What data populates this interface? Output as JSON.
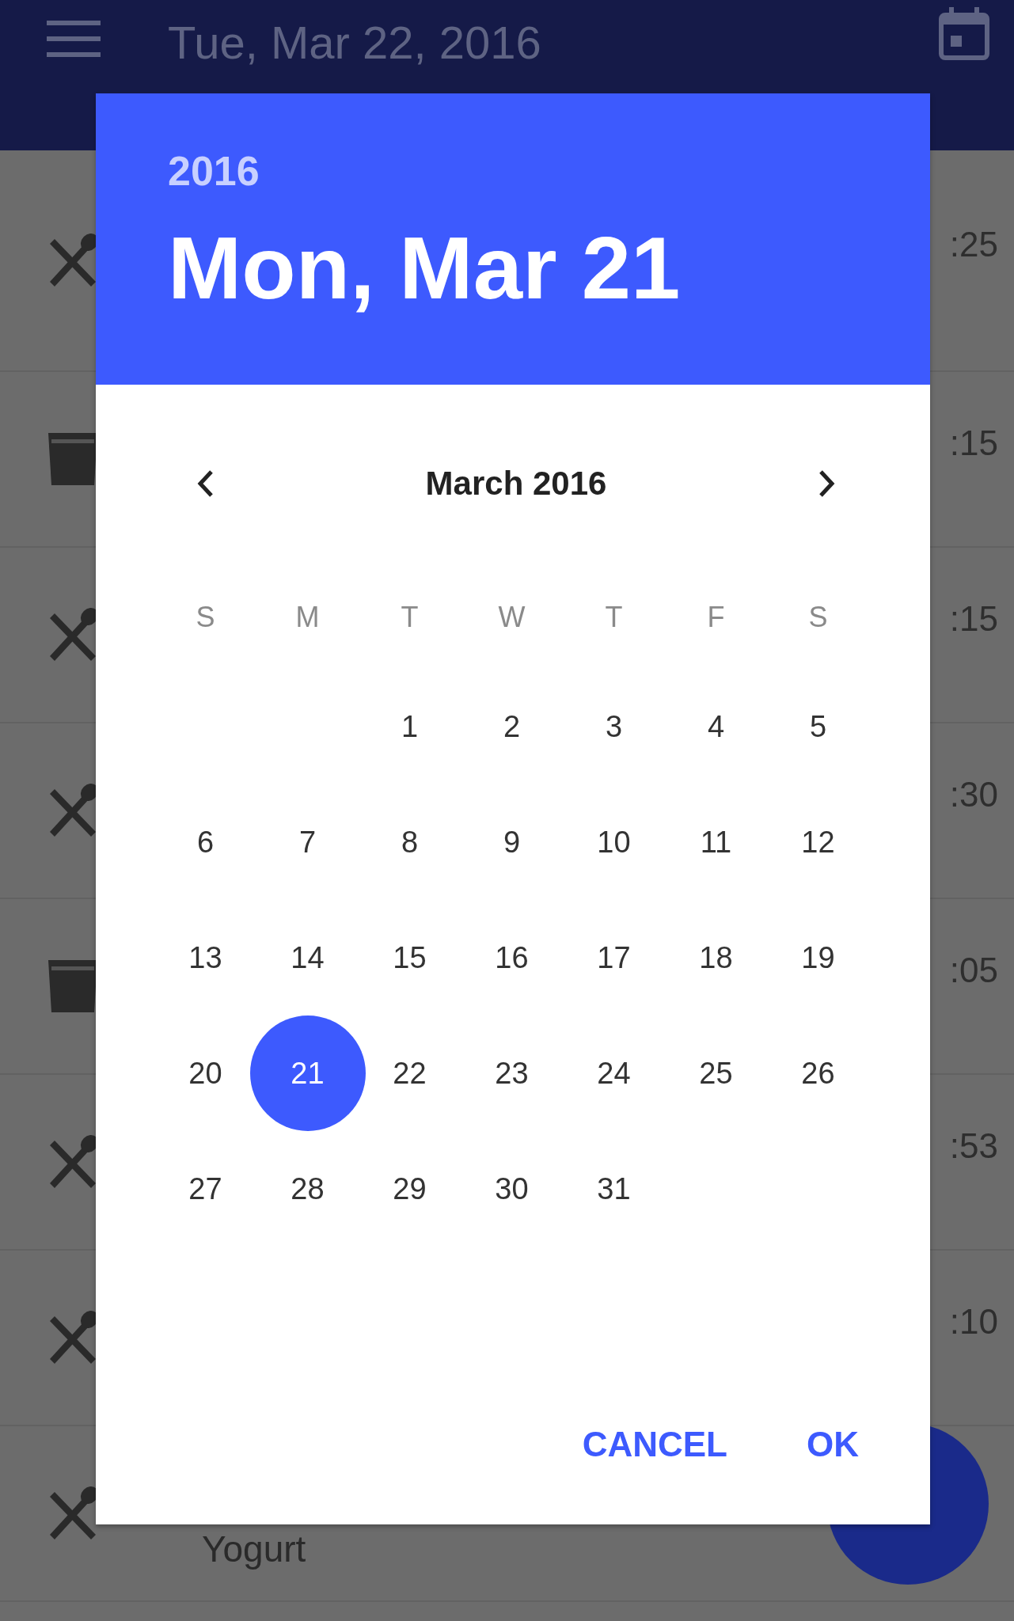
{
  "app_bar": {
    "title": "Tue, Mar 22, 2016"
  },
  "entries": [
    {
      "kind": "meal",
      "time": ":25"
    },
    {
      "kind": "drink",
      "time": ":15"
    },
    {
      "kind": "meal",
      "time": ":15"
    },
    {
      "kind": "meal",
      "time": ":30"
    },
    {
      "kind": "drink",
      "time": ":05"
    },
    {
      "kind": "meal",
      "time": ":53"
    },
    {
      "kind": "meal",
      "time": ":10"
    },
    {
      "kind": "meal",
      "name": "Yogurt"
    }
  ],
  "dialog": {
    "year": "2016",
    "date": "Mon, Mar 21",
    "month": "March 2016",
    "weekdays": [
      "S",
      "M",
      "T",
      "W",
      "T",
      "F",
      "S"
    ],
    "weeks": [
      [
        {
          "kind": "blank"
        },
        {
          "kind": "blank"
        },
        {
          "kind": "day",
          "day": "1",
          "selected": false
        },
        {
          "kind": "day",
          "day": "2",
          "selected": false
        },
        {
          "kind": "day",
          "day": "3",
          "selected": false
        },
        {
          "kind": "day",
          "day": "4",
          "selected": false
        },
        {
          "kind": "day",
          "day": "5",
          "selected": false
        }
      ],
      [
        {
          "kind": "day",
          "day": "6",
          "selected": false
        },
        {
          "kind": "day",
          "day": "7",
          "selected": false
        },
        {
          "kind": "day",
          "day": "8",
          "selected": false
        },
        {
          "kind": "day",
          "day": "9",
          "selected": false
        },
        {
          "kind": "day",
          "day": "10",
          "selected": false
        },
        {
          "kind": "day",
          "day": "11",
          "selected": false
        },
        {
          "kind": "day",
          "day": "12",
          "selected": false
        }
      ],
      [
        {
          "kind": "day",
          "day": "13",
          "selected": false
        },
        {
          "kind": "day",
          "day": "14",
          "selected": false
        },
        {
          "kind": "day",
          "day": "15",
          "selected": false
        },
        {
          "kind": "day",
          "day": "16",
          "selected": false
        },
        {
          "kind": "day",
          "day": "17",
          "selected": false
        },
        {
          "kind": "day",
          "day": "18",
          "selected": false
        },
        {
          "kind": "day",
          "day": "19",
          "selected": false
        }
      ],
      [
        {
          "kind": "day",
          "day": "20",
          "selected": false
        },
        {
          "kind": "day",
          "day": "21",
          "selected": true
        },
        {
          "kind": "day",
          "day": "22",
          "selected": false
        },
        {
          "kind": "day",
          "day": "23",
          "selected": false
        },
        {
          "kind": "day",
          "day": "24",
          "selected": false
        },
        {
          "kind": "day",
          "day": "25",
          "selected": false
        },
        {
          "kind": "day",
          "day": "26",
          "selected": false
        }
      ],
      [
        {
          "kind": "day",
          "day": "27",
          "selected": false
        },
        {
          "kind": "day",
          "day": "28",
          "selected": false
        },
        {
          "kind": "day",
          "day": "29",
          "selected": false
        },
        {
          "kind": "day",
          "day": "30",
          "selected": false
        },
        {
          "kind": "day",
          "day": "31",
          "selected": false
        },
        {
          "kind": "blank"
        },
        {
          "kind": "blank"
        }
      ]
    ],
    "buttons": [
      {
        "label": "CANCEL"
      },
      {
        "label": "OK"
      }
    ]
  }
}
